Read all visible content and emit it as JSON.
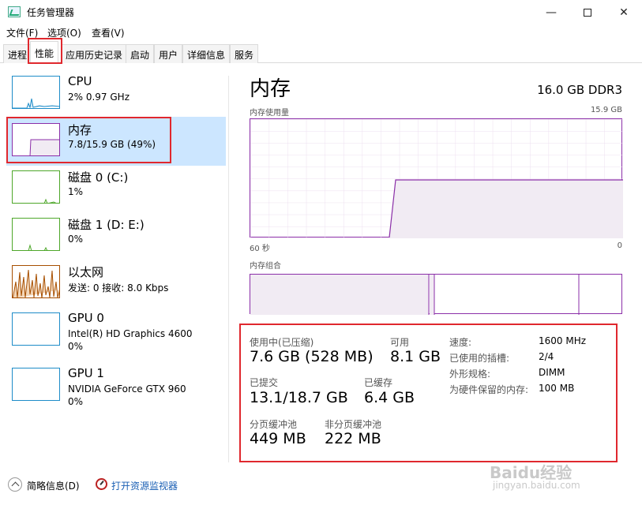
{
  "window": {
    "title": "任务管理器",
    "minimize_glyph": "—",
    "close_glyph": "✕"
  },
  "menu": {
    "file": "文件(F)",
    "options": "选项(O)",
    "view": "查看(V)"
  },
  "tabs": [
    "进程",
    "性能",
    "应用历史记录",
    "启动",
    "用户",
    "详细信息",
    "服务"
  ],
  "active_tab": "性能",
  "sidebar": {
    "items": [
      {
        "name": "CPU",
        "line1": "2%  0.97 GHz",
        "line2": "",
        "color": "#1e8cc8"
      },
      {
        "name": "内存",
        "line1": "7.8/15.9 GB (49%)",
        "line2": "",
        "color": "#8b2fa8"
      },
      {
        "name": "磁盘 0 (C:)",
        "line1": "1%",
        "line2": "",
        "color": "#4ea72a"
      },
      {
        "name": "磁盘 1 (D: E:)",
        "line1": "0%",
        "line2": "",
        "color": "#4ea72a"
      },
      {
        "name": "以太网",
        "line1": "发送: 0 接收: 8.0 Kbps",
        "line2": "",
        "color": "#a74f01"
      },
      {
        "name": "GPU 0",
        "line1": "Intel(R) HD Graphics 4600",
        "line2": "0%",
        "color": "#1e8cc8"
      },
      {
        "name": "GPU 1",
        "line1": "NVIDIA GeForce GTX 960",
        "line2": "0%",
        "color": "#1e8cc8"
      }
    ]
  },
  "panel": {
    "title": "内存",
    "spec": "16.0 GB DDR3",
    "usage_label": "内存使用量",
    "usage_max": "15.9 GB",
    "time_left": "60 秒",
    "time_right": "0",
    "composition_label": "内存组合"
  },
  "stats": {
    "in_use_label": "使用中(已压缩)",
    "in_use_value": "7.6 GB (528 MB)",
    "available_label": "可用",
    "available_value": "8.1 GB",
    "committed_label": "已提交",
    "committed_value": "13.1/18.7 GB",
    "cached_label": "已缓存",
    "cached_value": "6.4 GB",
    "paged_label": "分页缓冲池",
    "paged_value": "449 MB",
    "nonpaged_label": "非分页缓冲池",
    "nonpaged_value": "222 MB"
  },
  "specs": [
    {
      "label": "速度:",
      "value": "1600 MHz"
    },
    {
      "label": "已使用的插槽:",
      "value": "2/4"
    },
    {
      "label": "外形规格:",
      "value": "DIMM"
    },
    {
      "label": "为硬件保留的内存:",
      "value": "100 MB"
    }
  ],
  "footer": {
    "fewer_details": "简略信息(D)",
    "open_monitor": "打开资源监视器"
  },
  "watermark": {
    "main": "Baidu经验",
    "sub": "jingyan.baidu.com"
  },
  "colors": {
    "memory": "#8b2fa8",
    "memory_fill": "#f1ebf3",
    "highlight": "#e0282e",
    "selected": "#cce6ff"
  }
}
